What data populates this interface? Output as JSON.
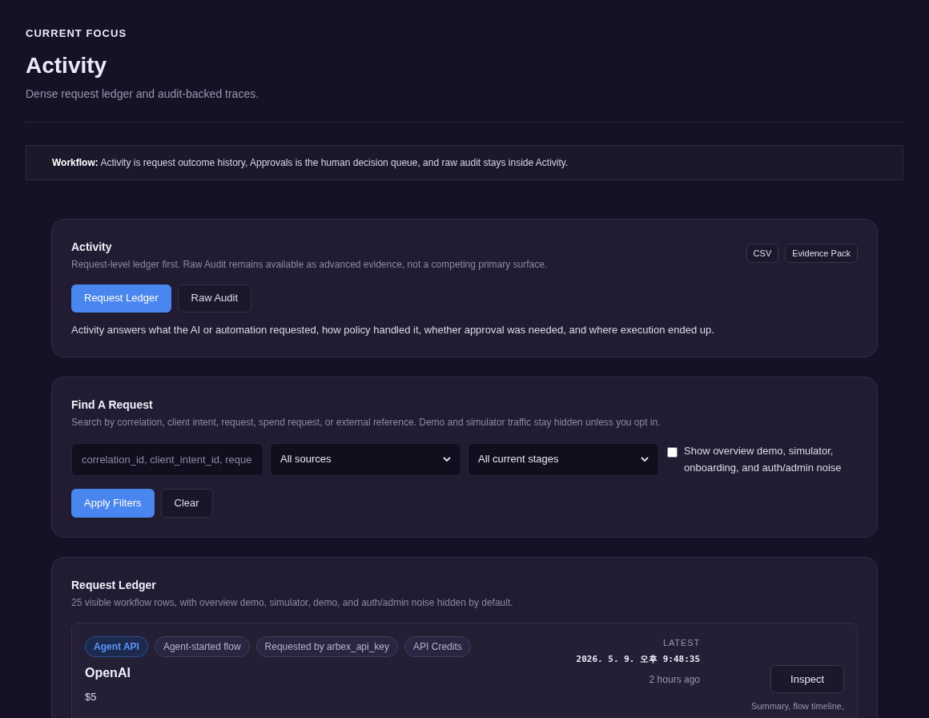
{
  "header": {
    "eyebrow": "CURRENT FOCUS",
    "title": "Activity",
    "subtitle": "Dense request ledger and audit-backed traces."
  },
  "workflow_note": {
    "label": "Workflow:",
    "text": "Activity is request outcome history, Approvals is the human decision queue, and raw audit stays inside Activity."
  },
  "activity_panel": {
    "title": "Activity",
    "description": "Request-level ledger first. Raw Audit remains available as advanced evidence, not a competing primary surface.",
    "exports": [
      "CSV",
      "Evidence Pack"
    ],
    "tabs": [
      {
        "label": "Request Ledger",
        "selected": true
      },
      {
        "label": "Raw Audit",
        "selected": false
      }
    ],
    "note": "Activity answers what the AI or automation requested, how policy handled it, whether approval was needed, and where execution ended up."
  },
  "filter_panel": {
    "title": "Find A Request",
    "description": "Search by correlation, client intent, request, spend request, or external reference. Demo and simulator traffic stay hidden unless you opt in.",
    "search": {
      "placeholder": "correlation_id, client_intent_id, reque"
    },
    "selects": [
      "All sources",
      "All current stages"
    ],
    "show_noise": {
      "label": "Show overview demo, simulator, onboarding, and auth/admin noise",
      "checked": false
    },
    "buttons": [
      {
        "label": "Apply Filters",
        "kind": "primary"
      },
      {
        "label": "Clear",
        "kind": "secondary"
      }
    ]
  },
  "ledger_panel": {
    "title": "Request Ledger",
    "description": "25 visible workflow rows, with overview demo, simulator, demo, and auth/admin noise hidden by default.",
    "rows": [
      {
        "tags": [
          {
            "label": "Agent API",
            "highlighted": true
          },
          {
            "label": "Agent-started flow",
            "highlighted": false
          },
          {
            "label": "Requested by arbex_api_key",
            "highlighted": false
          },
          {
            "label": "API Credits",
            "highlighted": false
          }
        ],
        "provider": "OpenAI",
        "amount": "$5",
        "latest_label": "LATEST",
        "timestamp": "2026. 5. 9. 오후 9:48:35",
        "relative_time": "2 hours ago",
        "action": "Inspect",
        "action_hint": "Summary, flow timeline,"
      }
    ]
  }
}
